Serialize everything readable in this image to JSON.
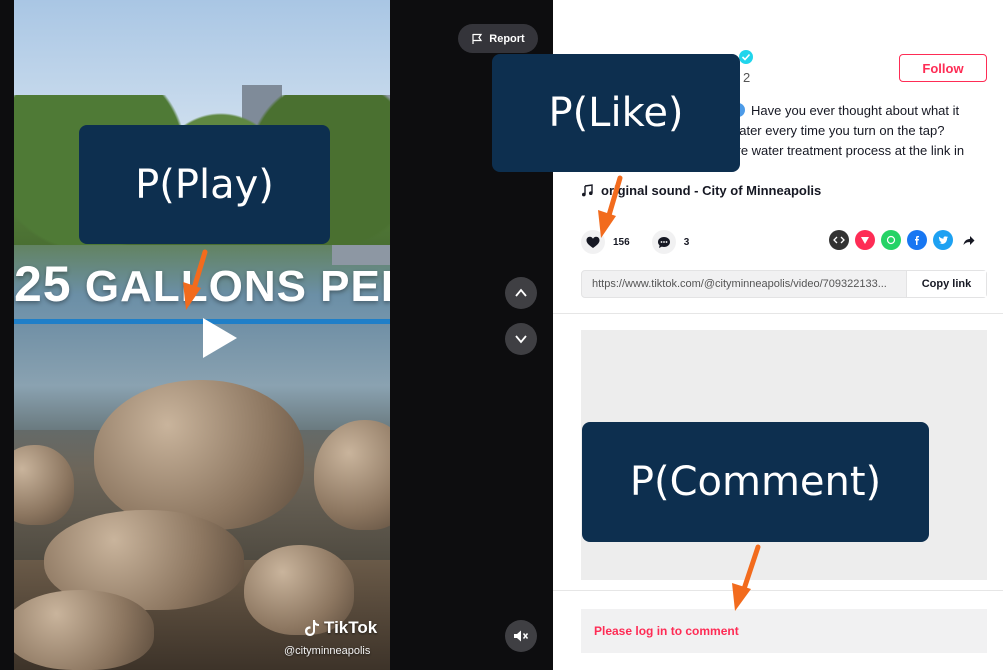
{
  "video": {
    "overlay_text_num": "25",
    "overlay_text_rest": "GALLONS PER S",
    "watermark_brand": "TikTok",
    "watermark_handle": "@cityminneapolis"
  },
  "controls": {
    "report_label": "Report"
  },
  "post": {
    "date_fragment": "2",
    "follow_label": "Follow",
    "caption_line1": "Have you ever thought about what it",
    "caption_line2": "g water every time you turn on the tap?",
    "caption_line3": "tire water treatment process at the link in",
    "music_label": "original sound - City of Minneapolis",
    "like_count": "156",
    "comment_count": "3",
    "share_link": "https://www.tiktok.com/@cityminneapolis/video/709322133...",
    "copy_label": "Copy link",
    "login_prompt": "Please log in to comment"
  },
  "annotations": {
    "play": "P(Play)",
    "like": "P(Like)",
    "comment": "P(Comment)"
  },
  "colors": {
    "accent": "#fe2c55",
    "annotation_bg": "#0d2f4f",
    "annotation_arrow": "#f26b1d"
  }
}
